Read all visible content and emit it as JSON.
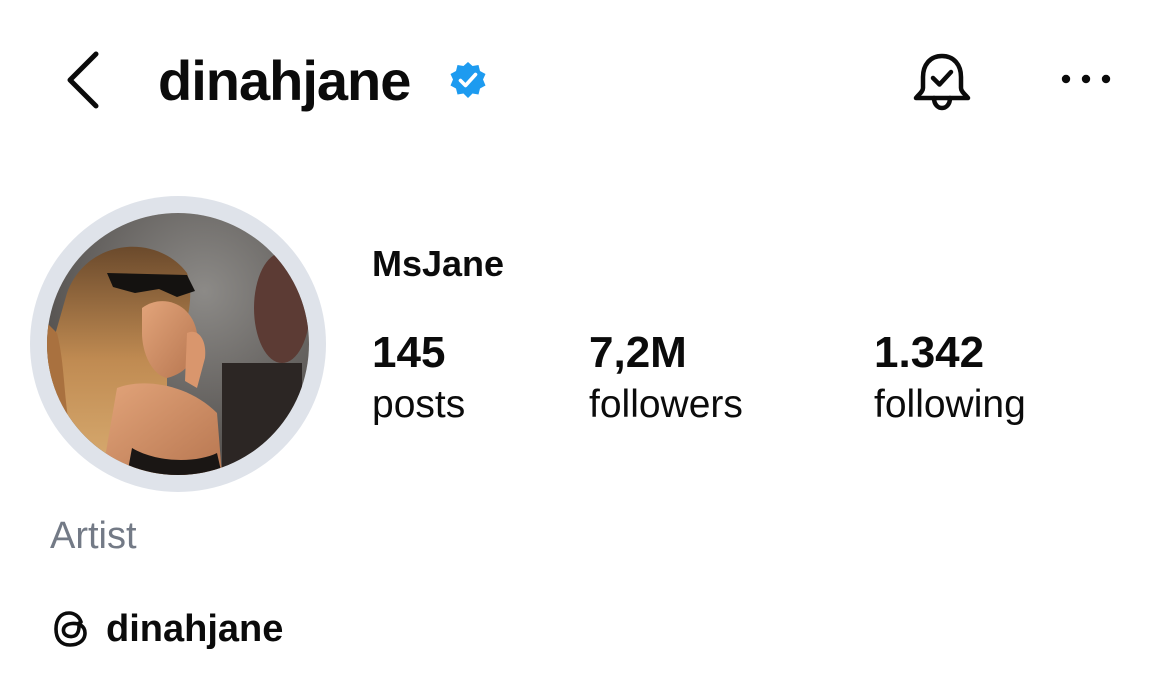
{
  "header": {
    "username": "dinahjane",
    "verified_icon": "verified-badge-icon",
    "back_icon": "chevron-left-icon",
    "notification_icon": "bell-check-icon",
    "more_icon": "more-horizontal-icon"
  },
  "profile": {
    "display_name": "MsJane",
    "category": "Artist",
    "stats": {
      "posts": {
        "value": "145",
        "label": "posts"
      },
      "followers": {
        "value": "7,2M",
        "label": "followers"
      },
      "following": {
        "value": "1.342",
        "label": "following"
      }
    },
    "threads": {
      "icon": "threads-icon",
      "handle": "dinahjane"
    }
  },
  "colors": {
    "verified_blue": "#1d9bf0",
    "text_primary": "#0b0b0b",
    "text_secondary": "#737a86",
    "avatar_ring": "#dfe3ea"
  }
}
